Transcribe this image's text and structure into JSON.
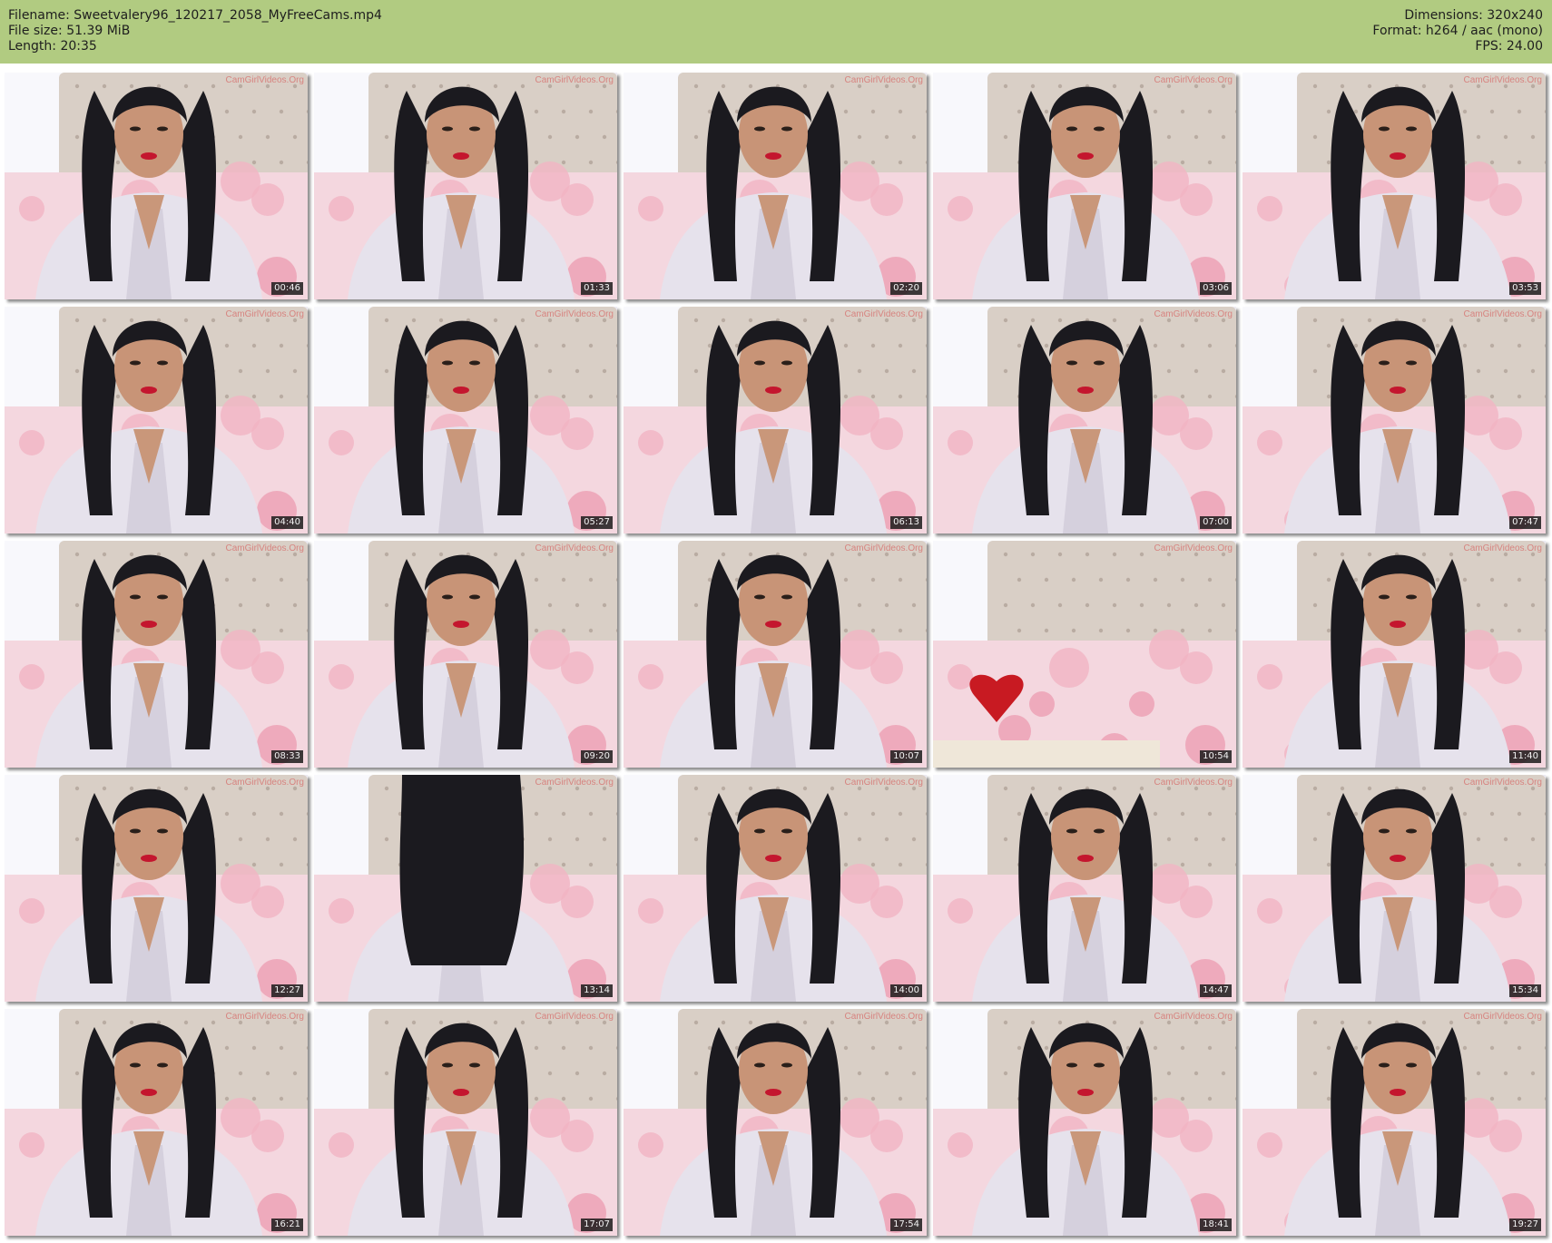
{
  "header": {
    "filename_line": "Filename: Sweetvalery96_120217_2058_MyFreeCams.mp4",
    "filesize_line": "File size: 51.39 MiB",
    "length_line": "Length: 20:35",
    "dimensions_line": "Dimensions: 320x240",
    "format_line": "Format: h264 / aac (mono)",
    "fps_line": "FPS: 24.00",
    "background_color": "#b1cb81"
  },
  "watermark": "CamGirlVideos.Org",
  "thumbnails": [
    {
      "time": "00:46",
      "scene": "person"
    },
    {
      "time": "01:33",
      "scene": "person"
    },
    {
      "time": "02:20",
      "scene": "person"
    },
    {
      "time": "03:06",
      "scene": "person"
    },
    {
      "time": "03:53",
      "scene": "person"
    },
    {
      "time": "04:40",
      "scene": "person"
    },
    {
      "time": "05:27",
      "scene": "person"
    },
    {
      "time": "06:13",
      "scene": "person"
    },
    {
      "time": "07:00",
      "scene": "person"
    },
    {
      "time": "07:47",
      "scene": "person"
    },
    {
      "time": "08:33",
      "scene": "person"
    },
    {
      "time": "09:20",
      "scene": "person"
    },
    {
      "time": "10:07",
      "scene": "person"
    },
    {
      "time": "10:54",
      "scene": "empty-bed"
    },
    {
      "time": "11:40",
      "scene": "person"
    },
    {
      "time": "12:27",
      "scene": "person"
    },
    {
      "time": "13:14",
      "scene": "person-hair-covered"
    },
    {
      "time": "14:00",
      "scene": "person"
    },
    {
      "time": "14:47",
      "scene": "person"
    },
    {
      "time": "15:34",
      "scene": "person"
    },
    {
      "time": "16:21",
      "scene": "person"
    },
    {
      "time": "17:07",
      "scene": "person"
    },
    {
      "time": "17:54",
      "scene": "person"
    },
    {
      "time": "18:41",
      "scene": "person"
    },
    {
      "time": "19:27",
      "scene": "person"
    }
  ]
}
